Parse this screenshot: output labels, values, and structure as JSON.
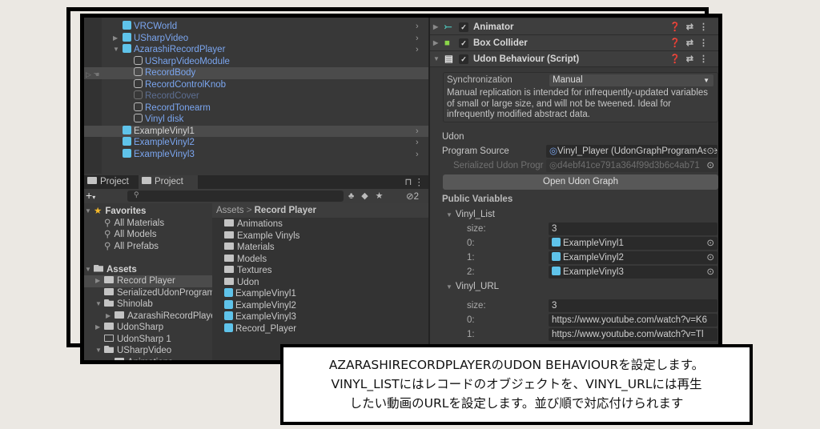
{
  "hierarchy": {
    "rows": [
      {
        "label": "VRCWorld",
        "level": 1,
        "icon": "prefab",
        "arrow": "",
        "state": "",
        "chevron": true
      },
      {
        "label": "USharpVideo",
        "level": 1,
        "icon": "prefab",
        "arrow": "right",
        "state": "",
        "chevron": true
      },
      {
        "label": "AzarashiRecordPlayer",
        "level": 1,
        "icon": "prefab",
        "arrow": "down",
        "state": "",
        "chevron": true
      },
      {
        "label": "USharpVideoModule",
        "level": 2,
        "icon": "object",
        "arrow": "",
        "state": "",
        "chevron": false
      },
      {
        "label": "RecordBody",
        "level": 2,
        "icon": "object",
        "arrow": "",
        "state": "sel",
        "chevron": false
      },
      {
        "label": "RecordControlKnob",
        "level": 2,
        "icon": "object",
        "arrow": "",
        "state": "",
        "chevron": false
      },
      {
        "label": "RecordCover",
        "level": 2,
        "icon": "object",
        "arrow": "",
        "state": "dim",
        "chevron": false
      },
      {
        "label": "RecordTonearm",
        "level": 2,
        "icon": "object",
        "arrow": "",
        "state": "",
        "chevron": false
      },
      {
        "label": "Vinyl disk",
        "level": 2,
        "icon": "object",
        "arrow": "",
        "state": "",
        "chevron": false
      },
      {
        "label": "ExampleVinyl1",
        "level": 1,
        "icon": "prefab",
        "arrow": "",
        "state": "sel-white",
        "chevron": true
      },
      {
        "label": "ExampleVinyl2",
        "level": 1,
        "icon": "prefab",
        "arrow": "",
        "state": "",
        "chevron": true
      },
      {
        "label": "ExampleVinyl3",
        "level": 1,
        "icon": "prefab",
        "arrow": "",
        "state": "",
        "chevron": true
      }
    ]
  },
  "project": {
    "tabs": [
      "Project",
      "Project"
    ],
    "hidden_count": "2",
    "search_placeholder": "",
    "tree": [
      {
        "label": "Favorites",
        "level": 0,
        "icon": "star",
        "arrow": "down",
        "bold": true
      },
      {
        "label": "All Materials",
        "level": 1,
        "icon": "search"
      },
      {
        "label": "All Models",
        "level": 1,
        "icon": "search"
      },
      {
        "label": "All Prefabs",
        "level": 1,
        "icon": "search"
      },
      {
        "label": "",
        "level": 0,
        "icon": "none"
      },
      {
        "label": "Assets",
        "level": 0,
        "icon": "folder-open",
        "arrow": "down",
        "bold": true
      },
      {
        "label": "Record Player",
        "level": 1,
        "icon": "folder",
        "arrow": "right",
        "selected": true
      },
      {
        "label": "SerializedUdonProgram",
        "level": 1,
        "icon": "folder"
      },
      {
        "label": "Shinolab",
        "level": 1,
        "icon": "folder-open",
        "arrow": "down"
      },
      {
        "label": "AzarashiRecordPlaye",
        "level": 2,
        "icon": "folder",
        "arrow": "right"
      },
      {
        "label": "UdonSharp",
        "level": 1,
        "icon": "folder",
        "arrow": "right"
      },
      {
        "label": "UdonSharp 1",
        "level": 1,
        "icon": "folder-empty"
      },
      {
        "label": "USharpVideo",
        "level": 1,
        "icon": "folder-open",
        "arrow": "down"
      },
      {
        "label": "Animations",
        "level": 2,
        "icon": "folder"
      }
    ],
    "breadcrumb": {
      "root": "Assets",
      "current": "Record Player"
    },
    "items": [
      {
        "label": "Animations",
        "icon": "folder"
      },
      {
        "label": "Example Vinyls",
        "icon": "folder"
      },
      {
        "label": "Materials",
        "icon": "folder"
      },
      {
        "label": "Models",
        "icon": "folder"
      },
      {
        "label": "Textures",
        "icon": "folder"
      },
      {
        "label": "Udon",
        "icon": "folder"
      },
      {
        "label": "ExampleVinyl1",
        "icon": "prefab"
      },
      {
        "label": "ExampleVinyl2",
        "icon": "prefab"
      },
      {
        "label": "ExampleVinyl3",
        "icon": "prefab"
      },
      {
        "label": "Record_Player",
        "icon": "prefab"
      }
    ]
  },
  "inspector": {
    "components": [
      {
        "name": "Animator",
        "icon": "animator-icon",
        "expanded": false
      },
      {
        "name": "Box Collider",
        "icon": "box-collider-icon",
        "expanded": false
      },
      {
        "name": "Udon Behaviour (Script)",
        "icon": "script-icon",
        "expanded": true
      }
    ],
    "sync_label": "Synchronization",
    "sync_value": "Manual",
    "sync_help": "Manual replication is intended for infrequently-updated variables of small or large size, and will not be tweened. Ideal for infrequently modified abstract data.",
    "udon_label": "Udon",
    "program_source_label": "Program Source",
    "program_source_value": "Vinyl_Player (UdonGraphProgramAsset)",
    "serialized_label": "Serialized Udon Progr",
    "serialized_value": "d4ebf41ce791a364f99d3b6c4ab71",
    "open_graph_label": "Open Udon Graph",
    "public_vars_label": "Public Variables",
    "vinyl_list": {
      "name": "Vinyl_List",
      "size_label": "size:",
      "size": "3",
      "items": [
        {
          "index": "0:",
          "value": "ExampleVinyl1"
        },
        {
          "index": "1:",
          "value": "ExampleVinyl2"
        },
        {
          "index": "2:",
          "value": "ExampleVinyl3"
        }
      ]
    },
    "vinyl_url": {
      "name": "Vinyl_URL",
      "size_label": "size:",
      "size": "3",
      "items": [
        {
          "index": "0:",
          "value": "https://www.youtube.com/watch?v=K6"
        },
        {
          "index": "1:",
          "value": "https://www.youtube.com/watch?v=Tl"
        }
      ]
    }
  },
  "caption": {
    "lines": [
      "AZARASHIRECORDPLAYERのUDON BEHAVIOURを設定します。",
      "VINYL_LISTにはレコードのオブジェクトを、VINYL_URLには再生",
      "したい動画のURLを設定します。並び順で対応付けられます"
    ]
  },
  "colors": {
    "prefab_text": "#7ba6f0",
    "prefab_icon": "#5fc3ea",
    "panel": "#383838",
    "field": "#2a2a2a"
  }
}
